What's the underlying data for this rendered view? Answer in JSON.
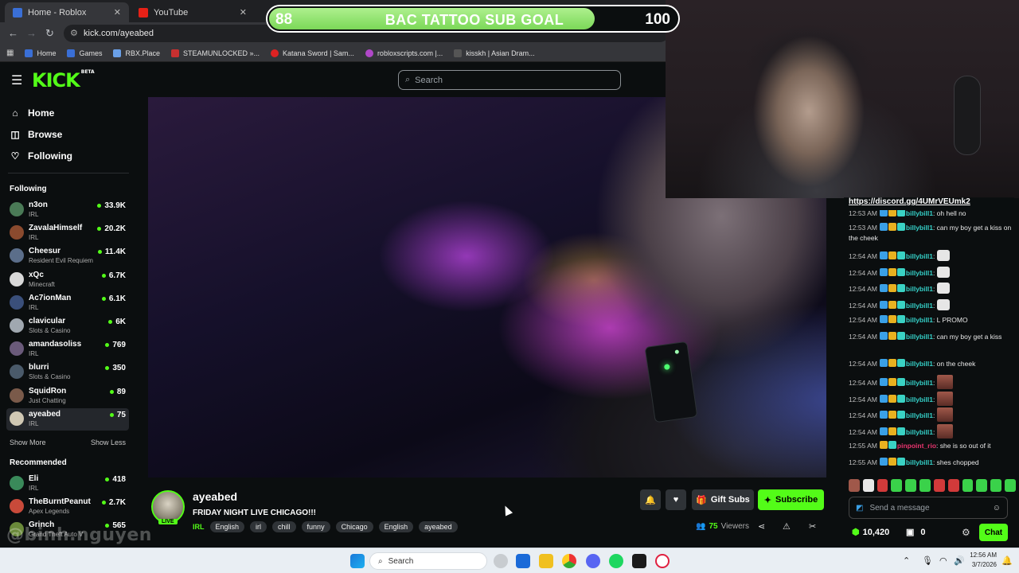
{
  "browser": {
    "tabs": [
      {
        "title": "Home - Roblox",
        "active": true,
        "close": "✕"
      },
      {
        "title": "YouTube",
        "active": false,
        "close": "✕"
      }
    ],
    "url": "kick.com/ayeabed",
    "bookmarks": [
      "Home",
      "Games",
      "RBX.Place",
      "STEAMUNLOCKED »...",
      "Katana Sword | Sam...",
      "robloxscripts.com |...",
      "kisskh | Asian Dram..."
    ]
  },
  "kick": {
    "logo": "KICK",
    "logo_badge": "BETA",
    "search_placeholder": "Search"
  },
  "sidebar": {
    "nav": [
      {
        "label": "Home",
        "icon": "home-icon"
      },
      {
        "label": "Browse",
        "icon": "browse-icon"
      },
      {
        "label": "Following",
        "icon": "heart-icon"
      }
    ],
    "following_title": "Following",
    "following": [
      {
        "name": "n3on",
        "category": "IRL",
        "viewers": "33.9K",
        "color": "#4a7a56"
      },
      {
        "name": "ZavalaHimself",
        "category": "IRL",
        "viewers": "20.2K",
        "color": "#8a4a2e"
      },
      {
        "name": "Cheesur",
        "category": "Resident Evil Requiem",
        "viewers": "11.4K",
        "color": "#5b6e8a"
      },
      {
        "name": "xQc",
        "category": "Minecraft",
        "viewers": "6.7K",
        "color": "#d8d8d8"
      },
      {
        "name": "Ac7ionMan",
        "category": "IRL",
        "viewers": "6.1K",
        "color": "#3a4f7a"
      },
      {
        "name": "clavicular",
        "category": "Slots & Casino",
        "viewers": "6K",
        "color": "#a0a8b0"
      },
      {
        "name": "amandasoliss",
        "category": "IRL",
        "viewers": "769",
        "color": "#6a5a7a"
      },
      {
        "name": "blurri",
        "category": "Slots & Casino",
        "viewers": "350",
        "color": "#4a5a6a"
      },
      {
        "name": "SquidRon",
        "category": "Just Chatting",
        "viewers": "89",
        "color": "#7a5a4a"
      },
      {
        "name": "ayeabed",
        "category": "IRL",
        "viewers": "75",
        "color": "#d0c8b4"
      }
    ],
    "show_more": "Show More",
    "show_less": "Show Less",
    "recommended_title": "Recommended",
    "recommended": [
      {
        "name": "Eli",
        "category": "IRL",
        "viewers": "418",
        "color": "#3a8a5a"
      },
      {
        "name": "TheBurntPeanut",
        "category": "Apex Legends",
        "viewers": "2.7K",
        "color": "#c84a3a"
      },
      {
        "name": "Grinch",
        "category": "Grand Theft Auto V",
        "viewers": "565",
        "color": "#6a8a3a"
      }
    ]
  },
  "overlay": {
    "goal_current": "88",
    "goal_title": "BAC TATTOO SUB GOAL",
    "goal_target": "100",
    "goal_progress": 0.88,
    "discord": "https://discord.gg/4UMrVEUmk2"
  },
  "stream": {
    "name": "ayeabed",
    "live": "LIVE",
    "title": "FRIDAY NIGHT LIVE CHICAGO!!!",
    "category": "IRL",
    "tags": [
      "English",
      "irl",
      "chill",
      "funny",
      "Chicago",
      "English",
      "ayeabed"
    ],
    "gift_subs": "Gift Subs",
    "subscribe": "Subscribe",
    "viewers": "75",
    "viewers_label": "Viewers"
  },
  "chat": {
    "messages": [
      {
        "time": "12:53 AM",
        "user": "billybill1",
        "text": "oh hell no",
        "badges": 3
      },
      {
        "time": "12:53 AM",
        "user": "billybill1",
        "text": "can my boy get a kiss on the cheek",
        "badges": 3
      },
      {
        "time": "12:54 AM",
        "user": "billybill1",
        "text": "",
        "emote": "ghost",
        "badges": 3
      },
      {
        "time": "12:54 AM",
        "user": "billybill1",
        "text": "",
        "emote": "ghost",
        "badges": 3
      },
      {
        "time": "12:54 AM",
        "user": "billybill1",
        "text": "",
        "emote": "ghost",
        "badges": 3
      },
      {
        "time": "12:54 AM",
        "user": "billybill1",
        "text": "",
        "emote": "ghost",
        "badges": 3
      },
      {
        "time": "12:54 AM",
        "user": "billybill1",
        "text": "L PROMO",
        "badges": 3
      },
      {
        "time": "12:54 AM",
        "user": "billybill1",
        "text": "can my boy get a kiss",
        "badges": 3
      },
      {
        "time": "12:54 AM",
        "user": "billybill1",
        "text": "on the cheek",
        "badges": 3
      },
      {
        "time": "12:54 AM",
        "user": "billybill1",
        "text": "",
        "emote": "face",
        "badges": 3
      },
      {
        "time": "12:54 AM",
        "user": "billybill1",
        "text": "",
        "emote": "face",
        "badges": 3
      },
      {
        "time": "12:54 AM",
        "user": "billybill1",
        "text": "",
        "emote": "face",
        "badges": 3
      },
      {
        "time": "12:54 AM",
        "user": "billybill1",
        "text": "",
        "emote": "face",
        "badges": 3
      },
      {
        "time": "12:55 AM",
        "user": "pinpoint_rio",
        "text": "she is so out of it",
        "badges": 2,
        "pink": true
      },
      {
        "time": "12:55 AM",
        "user": "billybill1",
        "text": "shes chopped",
        "badges": 3
      }
    ],
    "input_placeholder": "Send a message",
    "points": "10,420",
    "vault": "0",
    "chat_button": "Chat",
    "emote_colors": [
      "#a0584a",
      "#e8e8e8",
      "#d23a3a",
      "#3ad24a",
      "#3ad24a",
      "#3ad24a",
      "#d23a3a",
      "#d23a3a",
      "#3ad24a",
      "#3ad24a",
      "#3ad24a",
      "#3ad24a"
    ]
  },
  "watermark": "@binh.nguyen",
  "taskbar": {
    "search": "Search",
    "time": "12:56 AM",
    "date": "3/7/2026"
  }
}
